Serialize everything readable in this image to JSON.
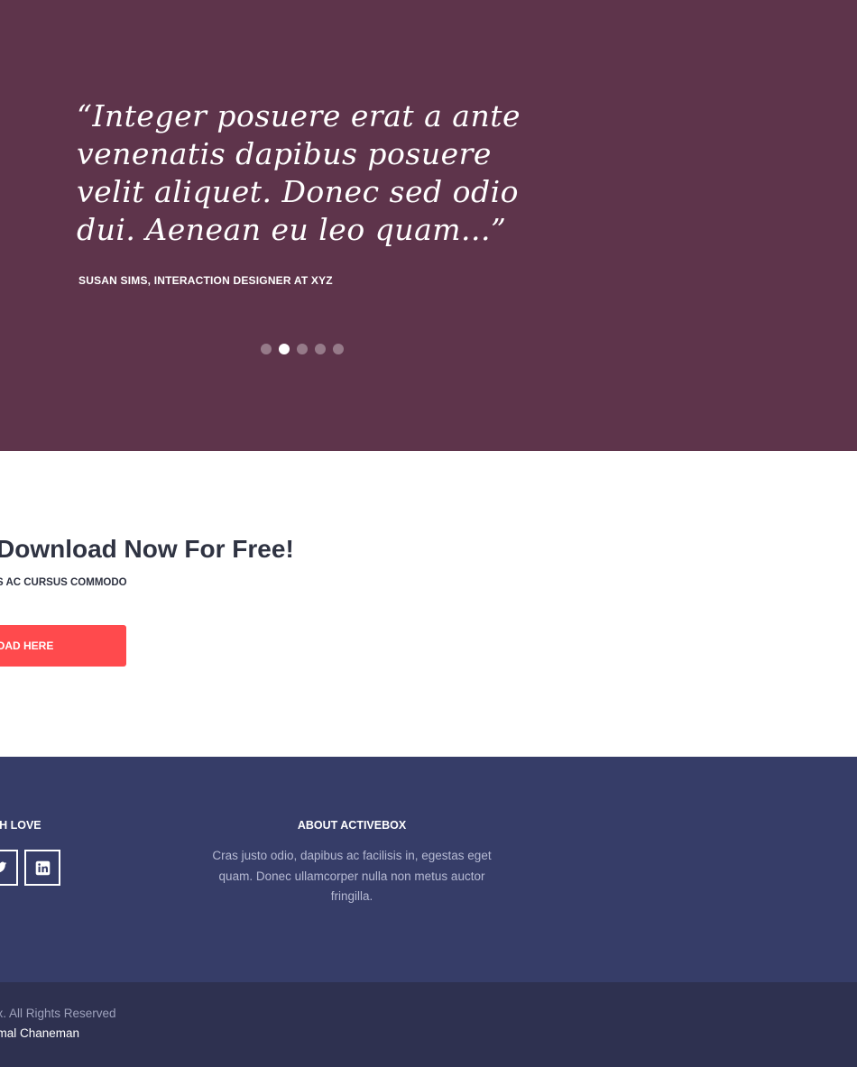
{
  "testimonial": {
    "quote": "“Integer posuere erat a ante venenatis dapibus posuere velit aliquet. Donec sed odio dui. Aenean eu leo quam...”",
    "author": "SUSAN SIMS, INTERACTION DESIGNER AT XYZ",
    "slides": {
      "count": 5,
      "active_index": 1
    }
  },
  "cta": {
    "title": "Download Now For Free!",
    "subtitle": "S AC CURSUS COMMODO",
    "button_label": "OAD HERE"
  },
  "footer": {
    "love_title": "ITH LOVE",
    "social_icons": [
      "twitter-icon",
      "linkedin-icon"
    ],
    "about_title": "ABOUT ACTIVEBOX",
    "about_text": "Cras justo odio, dapibus ac facilisis in, egestas eget quam. Donec ullamcorper nulla non metus auctor fringilla.",
    "copyright": "Box. All Rights Reserved",
    "credit": "Kamal Chaneman"
  },
  "colors": {
    "testimonial_bg": "#5e344b",
    "accent_button": "#ff4a4d",
    "footer_top_bg": "#363d68",
    "footer_bottom_bg": "#2e3150"
  }
}
